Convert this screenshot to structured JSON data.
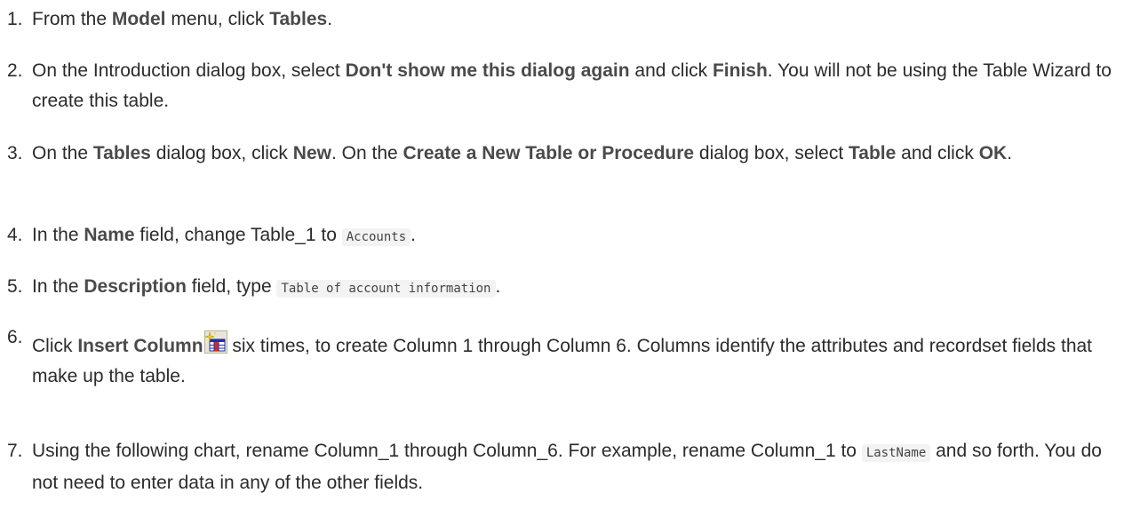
{
  "steps": [
    {
      "num": "1.",
      "parts": [
        {
          "t": "From the "
        },
        {
          "t": "Model",
          "b": true
        },
        {
          "t": " menu, click "
        },
        {
          "t": "Tables",
          "b": true
        },
        {
          "t": "."
        }
      ]
    },
    {
      "num": "2.",
      "parts": [
        {
          "t": "On the Introduction dialog box, select "
        },
        {
          "t": "Don't show me this dialog again",
          "b": true
        },
        {
          "t": " and click "
        },
        {
          "t": "Finish",
          "b": true
        },
        {
          "t": ". You will not be using the Table Wizard to create this table."
        }
      ]
    },
    {
      "num": "3.",
      "parts": [
        {
          "t": "On the "
        },
        {
          "t": "Tables",
          "b": true
        },
        {
          "t": " dialog box, click "
        },
        {
          "t": "New",
          "b": true
        },
        {
          "t": ". On the "
        },
        {
          "t": "Create a New Table or Procedure",
          "b": true
        },
        {
          "t": " dialog box, select "
        },
        {
          "t": "Table",
          "b": true
        },
        {
          "t": " and click "
        },
        {
          "t": "OK",
          "b": true
        },
        {
          "t": "."
        }
      ]
    },
    {
      "num": "4.",
      "parts": [
        {
          "t": "In the "
        },
        {
          "t": "Name",
          "b": true
        },
        {
          "t": " field, change Table_1 to "
        },
        {
          "t": "Accounts",
          "code": true
        },
        {
          "t": "."
        }
      ]
    },
    {
      "num": "5.",
      "parts": [
        {
          "t": "In the "
        },
        {
          "t": "Description",
          "b": true
        },
        {
          "t": " field, type "
        },
        {
          "t": "Table of account information",
          "code": true
        },
        {
          "t": "."
        }
      ]
    },
    {
      "num": "6.",
      "sup": true,
      "parts": [
        {
          "t": "Click "
        },
        {
          "t": "Insert Column",
          "b": true
        },
        {
          "icon": "insert-column-icon"
        },
        {
          "t": " six times, to create Column 1 through Column 6. Columns identify the attributes and recordset fields that make up the table."
        }
      ]
    },
    {
      "num": "7.",
      "parts": [
        {
          "t": "Using the following chart, rename Column_1 through Column_6. For example, rename Column_1 to "
        },
        {
          "t": "LastName",
          "code": true
        },
        {
          "t": " and so forth. You do not need to enter data in any of the other fields."
        }
      ]
    }
  ]
}
